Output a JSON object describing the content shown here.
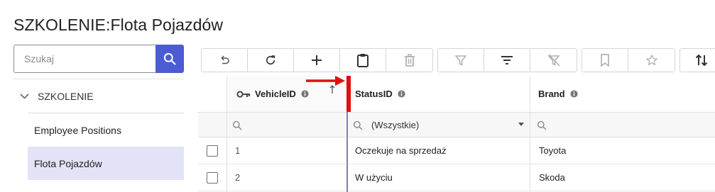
{
  "page": {
    "title": "SZKOLENIE:Flota Pojazdów"
  },
  "sidebar": {
    "search": {
      "placeholder": "Szukaj",
      "value": ""
    },
    "root": {
      "label": "SZKOLENIE",
      "expanded": true
    },
    "items": [
      {
        "label": "Employee Positions",
        "active": false
      },
      {
        "label": "Flota Pojazdów",
        "active": true
      }
    ]
  },
  "toolbar": {
    "groups": [
      [
        "undo-icon",
        "refresh-icon",
        "add-icon",
        "paste-icon",
        "delete-icon"
      ],
      [
        "filter-icon",
        "filter-list-icon",
        "clear-filter-icon"
      ],
      [
        "bookmark-icon",
        "star-icon"
      ],
      [
        "sort-icon"
      ]
    ]
  },
  "grid": {
    "columns": [
      {
        "label": "VehicleID",
        "key_icon": true,
        "sorted": "ascending"
      },
      {
        "label": "StatusID"
      },
      {
        "label": "Brand"
      }
    ],
    "filters": {
      "status": "(Wszystkie)"
    },
    "rows": [
      {
        "vehicle_id": "1",
        "status": "Oczekuje na sprzedaż",
        "brand": "Toyota"
      },
      {
        "vehicle_id": "2",
        "status": "W użyciu",
        "brand": "Skoda"
      }
    ]
  },
  "colors": {
    "accent": "#4a5bd4",
    "active_bg": "#e2e3f6",
    "annotation": "#e01010",
    "resize_line": "#7b7ec6"
  }
}
